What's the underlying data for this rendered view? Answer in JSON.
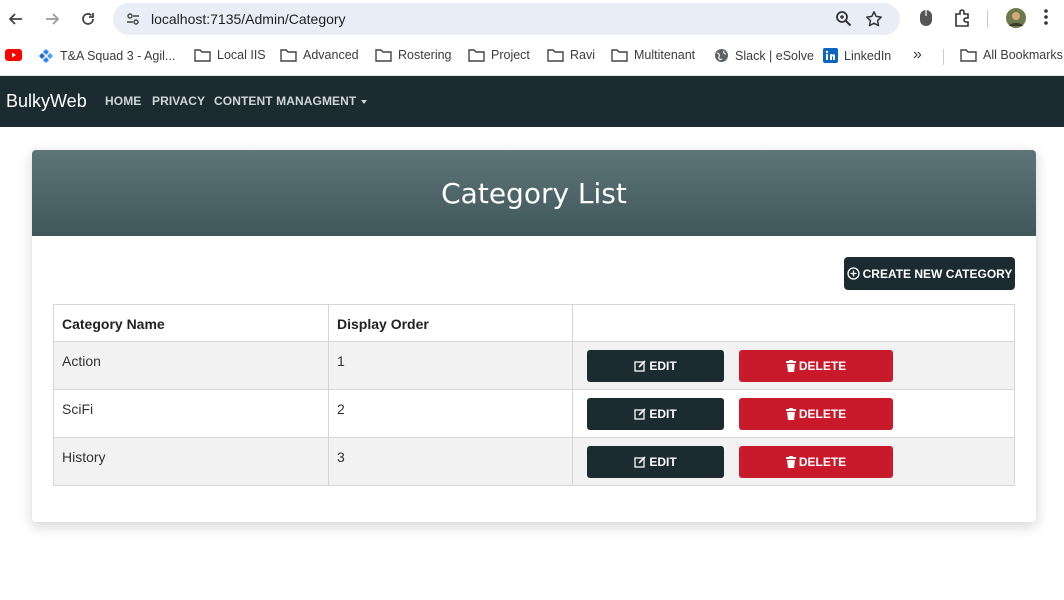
{
  "browser": {
    "url": "localhost:7135/Admin/Category",
    "bookmarks": [
      {
        "label": "T&A Squad 3 - Agil...",
        "icon": "jira-icon"
      },
      {
        "label": "Local IIS",
        "icon": "folder-icon"
      },
      {
        "label": "Advanced",
        "icon": "folder-icon"
      },
      {
        "label": "Rostering",
        "icon": "folder-icon"
      },
      {
        "label": "Project",
        "icon": "folder-icon"
      },
      {
        "label": "Ravi",
        "icon": "folder-icon"
      },
      {
        "label": "Multitenant",
        "icon": "folder-icon"
      },
      {
        "label": "Slack | eSolve",
        "icon": "globe-icon"
      },
      {
        "label": "LinkedIn",
        "icon": "linkedin-icon"
      }
    ],
    "more": "»",
    "all_bookmarks": "All Bookmarks"
  },
  "nav": {
    "brand": "BulkyWeb",
    "links": [
      "HOME",
      "PRIVACY",
      "CONTENT MANAGMENT"
    ]
  },
  "page": {
    "title": "Category List",
    "create_label": "CREATE NEW CATEGORY"
  },
  "table": {
    "headers": [
      "Category Name",
      "Display Order",
      ""
    ],
    "rows": [
      {
        "name": "Action",
        "order": "1"
      },
      {
        "name": "SciFi",
        "order": "2"
      },
      {
        "name": "History",
        "order": "3"
      }
    ],
    "edit_label": "EDIT",
    "delete_label": "DELETE"
  },
  "colors": {
    "navbar": "#1b2b2f",
    "danger": "#c91a2b",
    "header_gradient": "#5e7578"
  }
}
